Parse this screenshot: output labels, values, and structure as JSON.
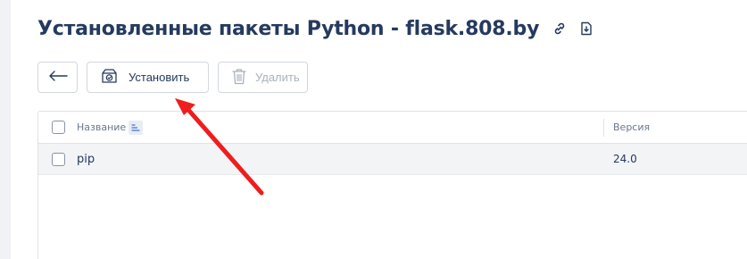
{
  "header": {
    "title": "Установленные пакеты Python - flask.808.by",
    "link_icon": "link-icon",
    "export_icon": "file-download-icon"
  },
  "toolbar": {
    "back_icon": "arrow-left-icon",
    "install_label": "Установить",
    "install_icon": "package-install-icon",
    "delete_label": "Удалить",
    "delete_icon": "trash-icon",
    "delete_disabled": true
  },
  "table": {
    "columns": [
      {
        "label": "Название",
        "sorted": "ascending"
      },
      {
        "label": "Версия"
      }
    ],
    "rows": [
      {
        "name": "pip",
        "version": "24.0"
      }
    ]
  },
  "annotation": {
    "arrow_color": "#ef1d1d",
    "points_to": "install-button"
  },
  "colors": {
    "title": "#253a5e",
    "border": "#d3d8df",
    "row_bg": "#f3f4f6",
    "disabled": "#a9b1bd"
  }
}
